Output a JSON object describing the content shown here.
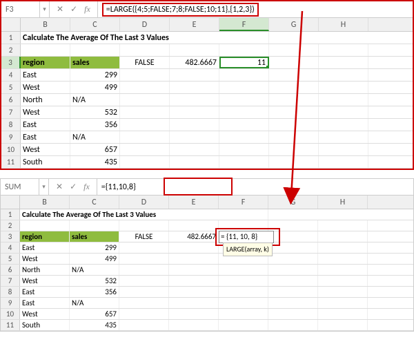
{
  "top": {
    "nameBox": "F3",
    "formula": "=LARGE({4;5;FALSE;7;8;FALSE;10;11},{1,2,3})",
    "cols": [
      "B",
      "C",
      "D",
      "E",
      "F",
      "G",
      "H"
    ],
    "title": "Calculate The Average Of The Last 3 Values",
    "headers": {
      "region": "region",
      "sales": "sales"
    },
    "rows": [
      {
        "n": "4",
        "region": "East",
        "sales": "299"
      },
      {
        "n": "5",
        "region": "West",
        "sales": "499"
      },
      {
        "n": "6",
        "region": "North",
        "sales": "N/A"
      },
      {
        "n": "7",
        "region": "West",
        "sales": "532"
      },
      {
        "n": "8",
        "region": "East",
        "sales": "356"
      },
      {
        "n": "9",
        "region": "East",
        "sales": "N/A"
      },
      {
        "n": "10",
        "region": "West",
        "sales": "657"
      },
      {
        "n": "11",
        "region": "South",
        "sales": "435"
      }
    ],
    "d3": "FALSE",
    "e3": "482.6667",
    "f3": "11"
  },
  "bottom": {
    "nameBox": "SUM",
    "formula": "={11,10,8}",
    "cols": [
      "B",
      "C",
      "D",
      "E",
      "F",
      "G",
      "H"
    ],
    "title": "Calculate The Average Of The Last 3 Values",
    "headers": {
      "region": "region",
      "sales": "sales"
    },
    "rows": [
      {
        "n": "4",
        "region": "East",
        "sales": "299"
      },
      {
        "n": "5",
        "region": "West",
        "sales": "499"
      },
      {
        "n": "6",
        "region": "North",
        "sales": "N/A"
      },
      {
        "n": "7",
        "region": "West",
        "sales": "532"
      },
      {
        "n": "8",
        "region": "East",
        "sales": "356"
      },
      {
        "n": "9",
        "region": "East",
        "sales": "N/A"
      },
      {
        "n": "10",
        "region": "West",
        "sales": "657"
      },
      {
        "n": "11",
        "region": "South",
        "sales": "435"
      }
    ],
    "d3": "FALSE",
    "e3": "482.6667",
    "f3": "= {11, 10, 8}",
    "tooltip": "LARGE(array, k)"
  },
  "icons": {
    "cancel": "✕",
    "enter": "✓",
    "fx": "fx",
    "dd": "▾"
  }
}
